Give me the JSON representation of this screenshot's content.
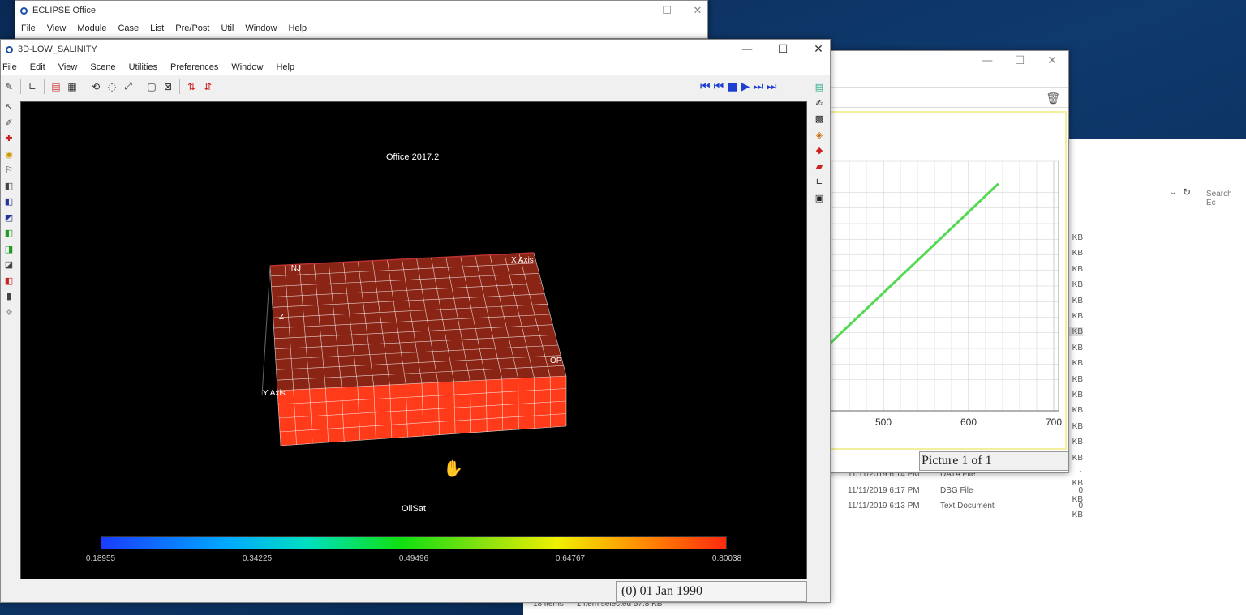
{
  "office": {
    "title": "ECLIPSE Office",
    "menu": [
      "File",
      "View",
      "Module",
      "Case",
      "List",
      "Pre/Post",
      "Util",
      "Window",
      "Help"
    ],
    "controls": [
      "—",
      "☐",
      "✕"
    ]
  },
  "win3d": {
    "title": "3D-LOW_SALINITY",
    "menu": [
      "File",
      "Edit",
      "View",
      "Scene",
      "Utilities",
      "Preferences",
      "Window",
      "Help"
    ],
    "controls": [
      "—",
      "☐",
      "✕"
    ],
    "animation_controls": [
      "⏮",
      "⏮",
      "■",
      "▶",
      "⏭",
      "⏭"
    ],
    "viewport": {
      "header": "Office 2017.2",
      "labels": {
        "inj": "INJ",
        "x_axis": "X Axis",
        "y_axis": "Y Axis",
        "z": "Z",
        "op": "OP"
      },
      "property": "OilSat",
      "colorbar_ticks": [
        "0.18955",
        "0.34225",
        "0.49496",
        "0.64767",
        "0.80038"
      ],
      "grid_colors": {
        "top": "#8a2414",
        "side": "#ff3b1a",
        "lines": "#ffffff"
      }
    },
    "time_label": "(0) 01 Jan 1990"
  },
  "plotwin": {
    "controls": [
      "—",
      "☐",
      "✕"
    ],
    "caption": "Picture 1 of 1",
    "chart_data": {
      "type": "line",
      "x_ticks": [
        "500",
        "600",
        "700"
      ],
      "series": [
        {
          "color": "#55d955",
          "x": [
            425,
            635
          ],
          "y_frac": [
            0.23,
            0.91
          ]
        }
      ],
      "grid": true
    }
  },
  "explorer": {
    "search_placeholder": "Search Ec",
    "sizes": [
      "KB",
      "KB",
      "KB",
      "KB",
      "KB",
      "KB",
      "KB",
      "KB",
      "KB",
      "KB",
      "KB",
      "KB",
      "KB",
      "KB",
      "KB"
    ],
    "files": [
      {
        "date": "11/11/2019 6:14 PM",
        "type": "DATA File",
        "size": "1 KB"
      },
      {
        "date": "11/11/2019 6:17 PM",
        "type": "DBG File",
        "size": "0 KB"
      },
      {
        "date": "11/11/2019 6:13 PM",
        "type": "Text Document",
        "size": "0 KB"
      }
    ],
    "status_items": "18 items",
    "status_selected": "1 item selected  57.8 KB"
  }
}
